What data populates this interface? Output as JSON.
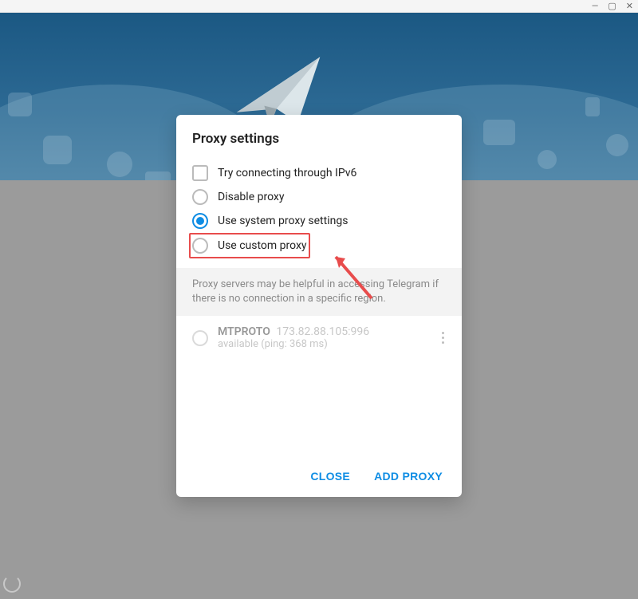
{
  "window": {
    "min": "—",
    "max": "▢",
    "close": "✕"
  },
  "modal": {
    "title": "Proxy settings",
    "checkbox_ipv6": "Try connecting through IPv6",
    "radio_disable": "Disable proxy",
    "radio_system": "Use system proxy settings",
    "radio_custom": "Use custom proxy",
    "info": "Proxy servers may be helpful in accessing Telegram if there is no connection in a specific region.",
    "proxy": {
      "protocol": "MTPROTO",
      "address": "173.82.88.105:996",
      "status": "available (ping: 368 ms)"
    },
    "close_btn": "CLOSE",
    "add_btn": "ADD PROXY"
  }
}
